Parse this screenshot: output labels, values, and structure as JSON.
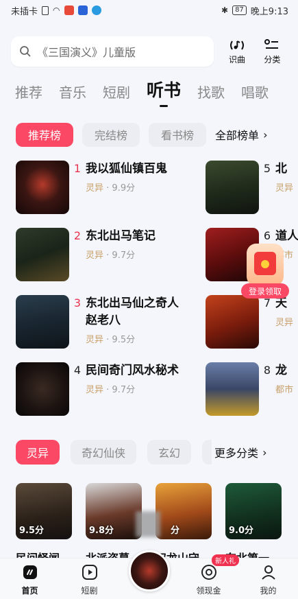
{
  "status_bar": {
    "carrier": "未插卡",
    "battery": "87",
    "time": "晚上9:13"
  },
  "search": {
    "placeholder": "《三国演义》儿童版",
    "identify_label": "识曲",
    "category_label": "分类"
  },
  "main_tabs": [
    "推荐",
    "音乐",
    "短剧",
    "听书",
    "找歌",
    "唱歌"
  ],
  "rank_tabs": [
    "推荐榜",
    "完结榜",
    "看书榜"
  ],
  "all_rankings_label": "全部榜单",
  "rank_items": [
    {
      "rank": "1",
      "title": "我以狐仙镇百鬼",
      "category": "灵异",
      "score": "9.9分"
    },
    {
      "rank": "2",
      "title": "东北出马笔记",
      "category": "灵异",
      "score": "9.7分"
    },
    {
      "rank": "3",
      "title": "东北出马仙之奇人赵老八",
      "category": "灵异",
      "score": "9.5分"
    },
    {
      "rank": "4",
      "title": "民间奇门风水秘术",
      "category": "灵异",
      "score": "9.7分"
    },
    {
      "rank": "5",
      "title": "北",
      "category": "灵异",
      "score": ""
    },
    {
      "rank": "6",
      "title": "道人",
      "category": "都市",
      "score": ""
    },
    {
      "rank": "7",
      "title": "天",
      "category": "灵异",
      "score": ""
    },
    {
      "rank": "8",
      "title": "龙",
      "category": "都市",
      "score": ""
    }
  ],
  "promo": {
    "label": "登录领取"
  },
  "category_tabs": [
    "灵异",
    "奇幻仙侠",
    "玄幻"
  ],
  "more_categories_label": "更多分类",
  "grid_items": [
    {
      "title": "民间怪闻",
      "score": "9.5分"
    },
    {
      "title": "北派盗墓",
      "score": "9.8分"
    },
    {
      "title": "双龙山守",
      "score": "分"
    },
    {
      "title": "东北第一",
      "score": "9.0分"
    }
  ],
  "bottom_nav": {
    "home": "首页",
    "shorts": "短剧",
    "coins": "领现金",
    "new_badge": "新人礼",
    "mine": "我的"
  }
}
